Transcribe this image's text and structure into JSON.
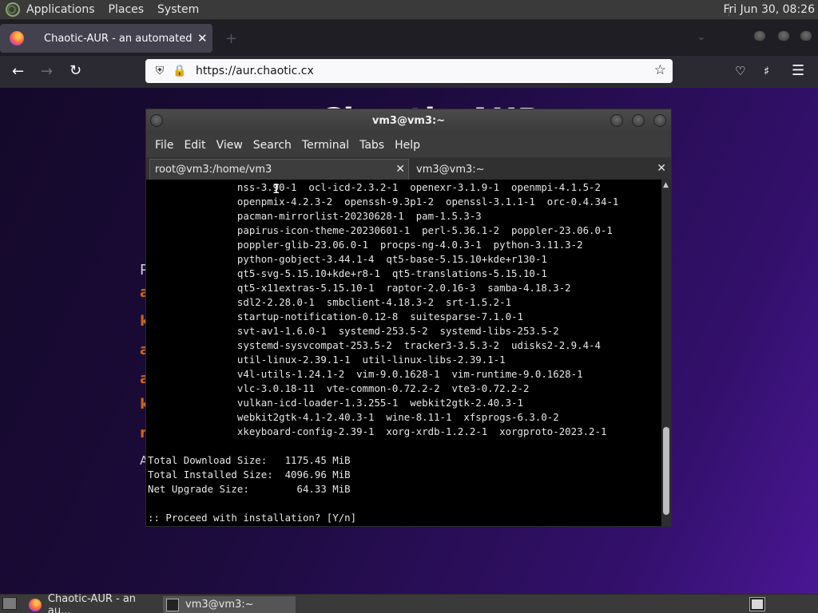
{
  "top_panel": {
    "menus": [
      "Applications",
      "Places",
      "System"
    ],
    "clock": "Fri Jun 30, 08:26"
  },
  "browser": {
    "tab_title": "Chaotic-AUR - an automated bu",
    "tab_close": "✕",
    "new_tab": "+",
    "url": "https://aur.chaotic.cx",
    "page_title_fragment": "Chaotic-AUR",
    "bg_fragments": [
      "P",
      "a",
      "k",
      "a",
      "a",
      "k",
      "n",
      "A"
    ]
  },
  "terminal": {
    "window_title": "vm3@vm3:~",
    "menus": [
      "File",
      "Edit",
      "View",
      "Search",
      "Terminal",
      "Tabs",
      "Help"
    ],
    "tabs": [
      {
        "label": "root@vm3:/home/vm3",
        "close": "✕"
      },
      {
        "label": "vm3@vm3:~",
        "close": "✕"
      }
    ],
    "lines": [
      "               nss-3.90-1  ocl-icd-2.3.2-1  openexr-3.1.9-1  openmpi-4.1.5-2",
      "               openpmix-4.2.3-2  openssh-9.3p1-2  openssl-3.1.1-1  orc-0.4.34-1",
      "               pacman-mirrorlist-20230628-1  pam-1.5.3-3",
      "               papirus-icon-theme-20230601-1  perl-5.36.1-2  poppler-23.06.0-1",
      "               poppler-glib-23.06.0-1  procps-ng-4.0.3-1  python-3.11.3-2",
      "               python-gobject-3.44.1-4  qt5-base-5.15.10+kde+r130-1",
      "               qt5-svg-5.15.10+kde+r8-1  qt5-translations-5.15.10-1",
      "               qt5-x11extras-5.15.10-1  raptor-2.0.16-3  samba-4.18.3-2",
      "               sdl2-2.28.0-1  smbclient-4.18.3-2  srt-1.5.2-1",
      "               startup-notification-0.12-8  suitesparse-7.1.0-1",
      "               svt-av1-1.6.0-1  systemd-253.5-2  systemd-libs-253.5-2",
      "               systemd-sysvcompat-253.5-2  tracker3-3.5.3-2  udisks2-2.9.4-4",
      "               util-linux-2.39.1-1  util-linux-libs-2.39.1-1",
      "               v4l-utils-1.24.1-2  vim-9.0.1628-1  vim-runtime-9.0.1628-1",
      "               vlc-3.0.18-11  vte-common-0.72.2-2  vte3-0.72.2-2",
      "               vulkan-icd-loader-1.3.255-1  webkit2gtk-2.40.3-1",
      "               webkit2gtk-4.1-2.40.3-1  wine-8.11-1  xfsprogs-6.3.0-2",
      "               xkeyboard-config-2.39-1  xorg-xrdb-1.2.2-1  xorgproto-2023.2-1",
      "",
      "Total Download Size:   1175.45 MiB",
      "Total Installed Size:  4096.96 MiB",
      "Net Upgrade Size:        64.33 MiB",
      "",
      ":: Proceed with installation? [Y/n]"
    ]
  },
  "taskbar": {
    "items": [
      {
        "label": "Chaotic-AUR - an au..."
      },
      {
        "label": "vm3@vm3:~"
      }
    ]
  },
  "colors": {
    "page_bg_start": "#14092a",
    "page_bg_end": "#4a1694",
    "accent_orange": "#c8641a"
  }
}
